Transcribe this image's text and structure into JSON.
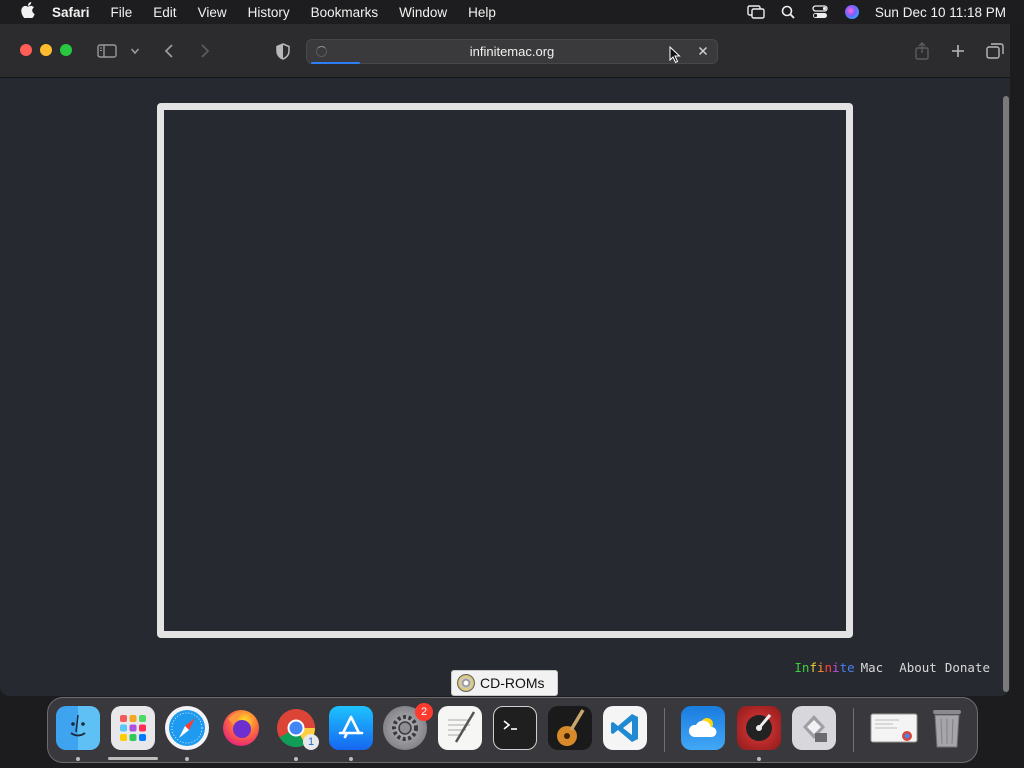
{
  "menubar": {
    "apple_icon": "apple-logo-icon",
    "app_name": "Safari",
    "items": [
      "File",
      "Edit",
      "View",
      "History",
      "Bookmarks",
      "Window",
      "Help"
    ],
    "status_icons": [
      "screen-mirroring-icon",
      "spotlight-search-icon",
      "control-center-icon",
      "siri-icon"
    ],
    "clock": "Sun Dec 10  11:18 PM"
  },
  "toolbar": {
    "address": "infinitemac.org",
    "progress": 0.12
  },
  "page": {
    "brand": "Infinite",
    "brand_suffix": "Mac",
    "links": [
      "About",
      "Donate"
    ]
  },
  "cdroms": {
    "label": "CD-ROMs"
  },
  "dock": {
    "apps": [
      "Finder",
      "Launchpad",
      "Safari",
      "Firefox",
      "Google Chrome",
      "App Store",
      "System Settings",
      "TextEdit",
      "Terminal",
      "GarageBand",
      "Visual Studio Code",
      "Weather",
      "Digital Color Meter",
      "Boot Camp Assistant",
      "Downloads",
      "Trash"
    ],
    "badges": {
      "settings": "2",
      "chrome": "1"
    }
  },
  "colors": {
    "accent": "#2f7df6",
    "window_bg": "#262a30",
    "frame": "#e3e3e3"
  }
}
